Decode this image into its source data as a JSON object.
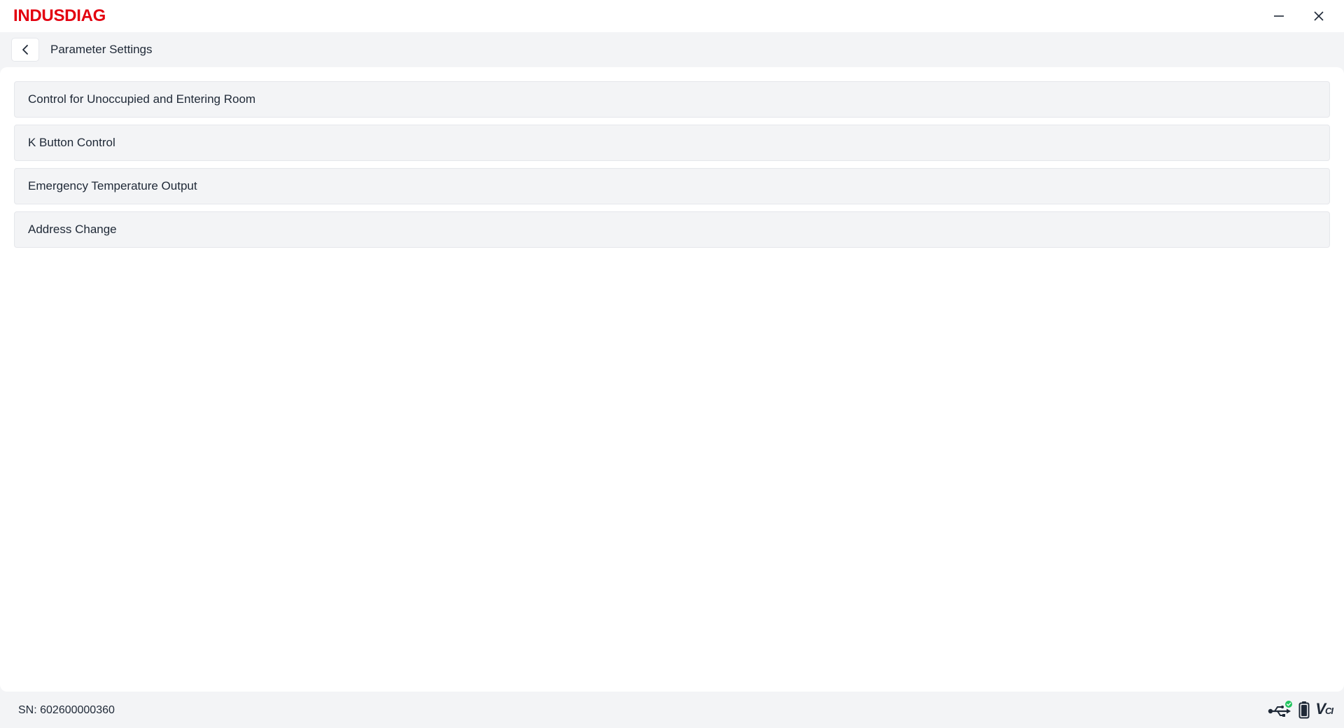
{
  "app": {
    "brand": "INDUSDIAG"
  },
  "window": {
    "minimize_icon": "minimize-icon",
    "close_icon": "close-icon"
  },
  "nav": {
    "back_icon": "chevron-left-icon",
    "title": "Parameter Settings"
  },
  "menu": {
    "items": [
      {
        "label": "Control for Unoccupied and Entering Room"
      },
      {
        "label": "K Button Control"
      },
      {
        "label": "Emergency Temperature Output"
      },
      {
        "label": "Address Change"
      }
    ]
  },
  "status": {
    "sn": "SN: 602600000360",
    "usb_icon": "usb-connected-icon",
    "battery_icon": "battery-icon",
    "vci_label": "V",
    "vci_sub": "CI",
    "connected_color": "#22c55e"
  },
  "colors": {
    "brand": "#e3000f"
  }
}
